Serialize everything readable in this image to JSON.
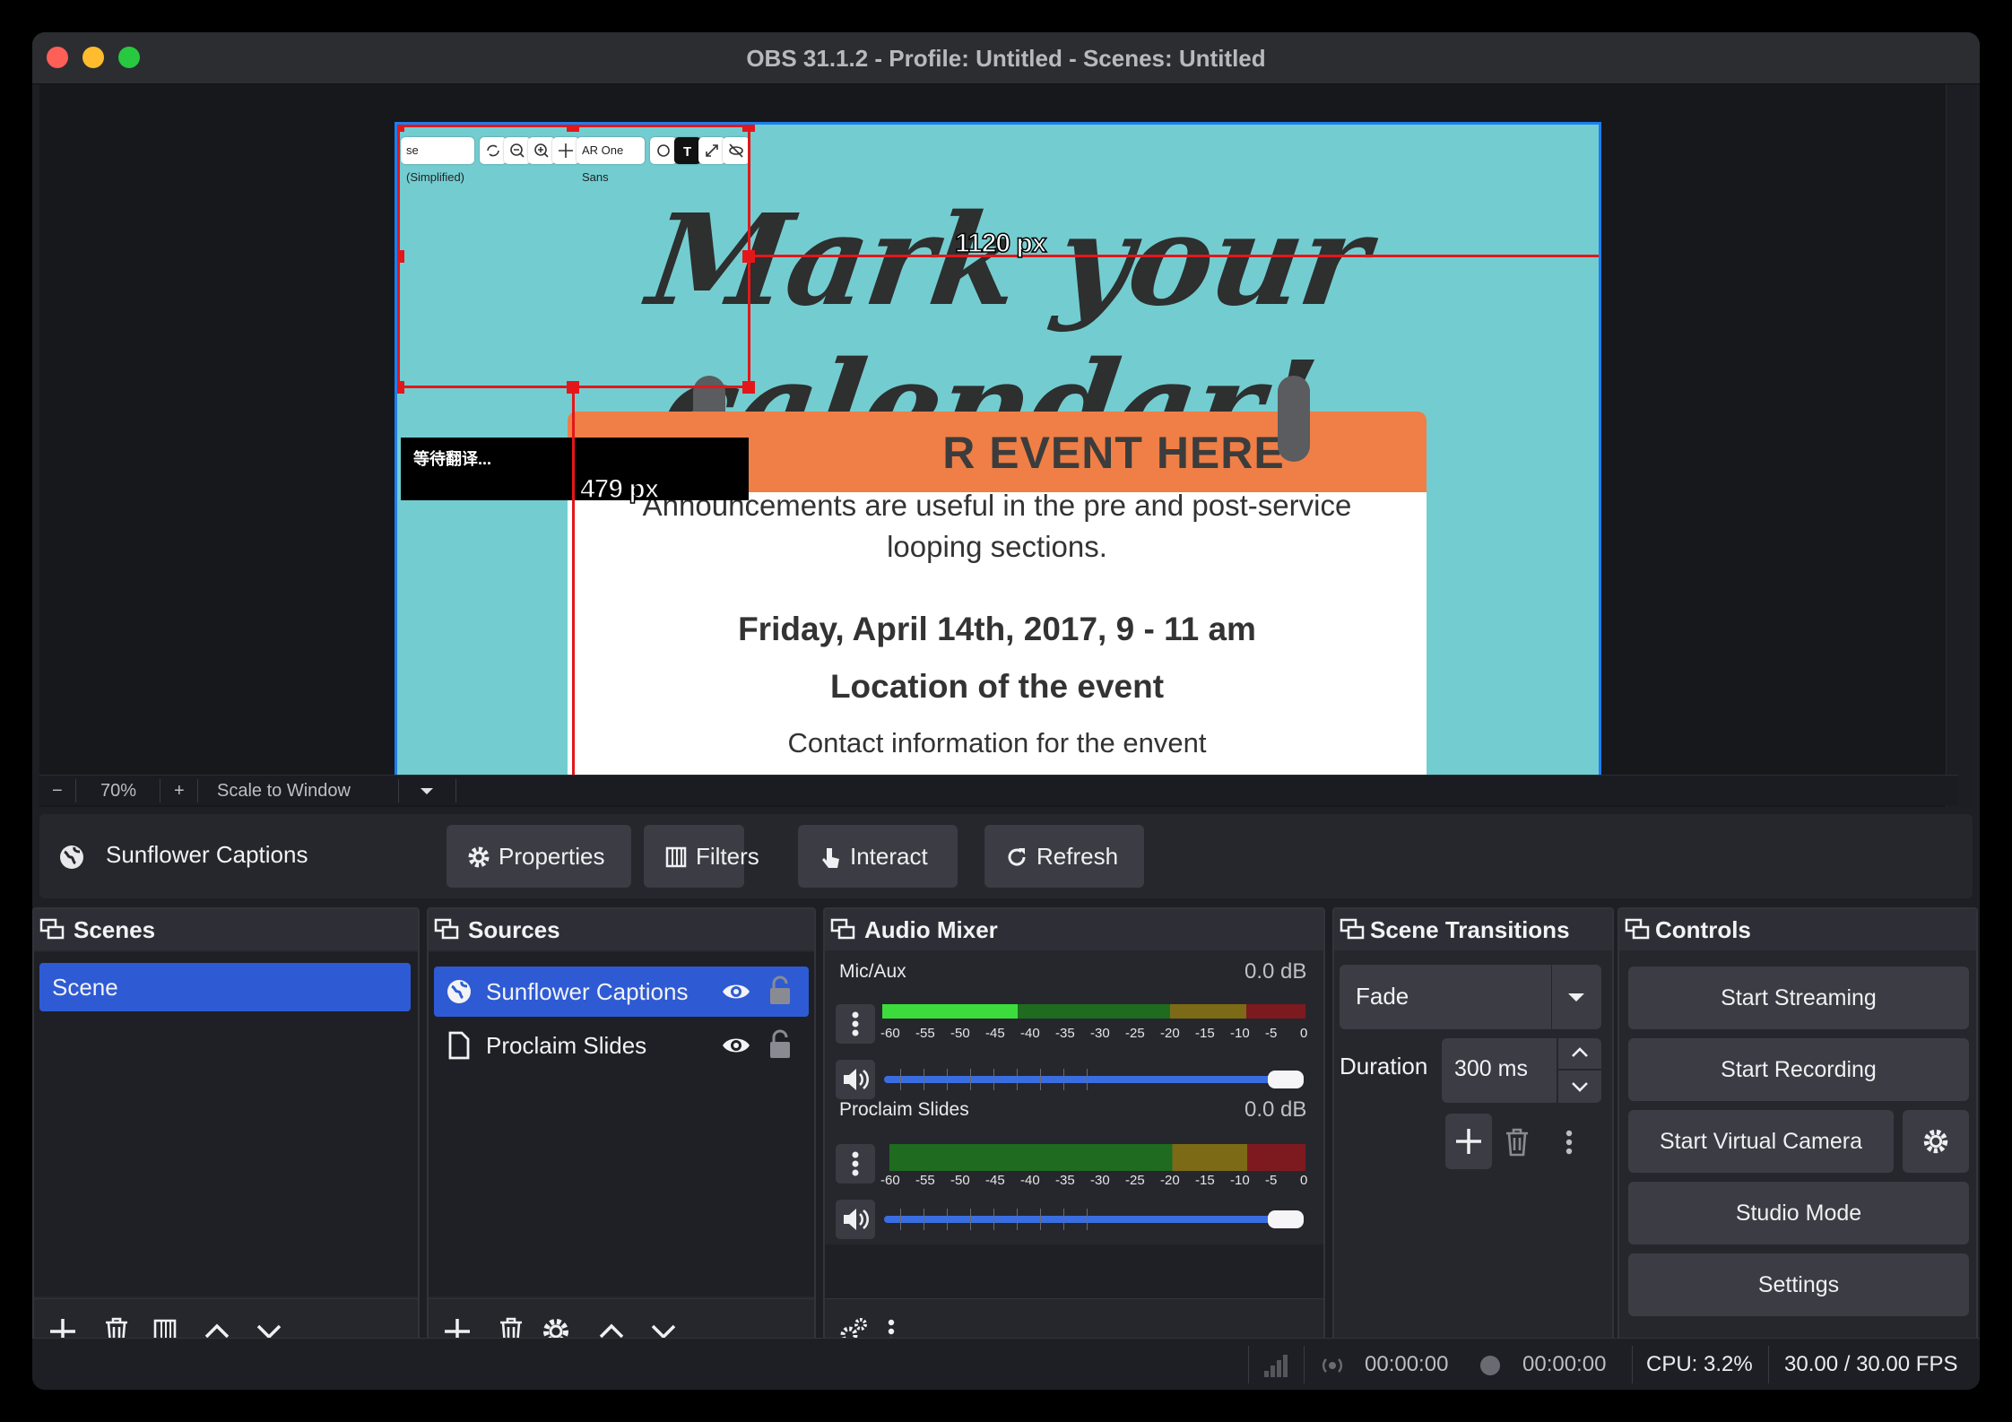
{
  "window": {
    "title": "OBS 31.1.2 - Profile: Untitled - Scenes: Untitled",
    "traffic_colors": {
      "close": "#ff5f57",
      "minimize": "#febc2e",
      "zoom": "#28c840"
    }
  },
  "preview": {
    "slide": {
      "headline": "Mark your calendar!",
      "header_text": "R EVENT HERE",
      "announcement_1": "Announcements are useful in the pre and post-service",
      "announcement_2": "looping sections.",
      "date": "Friday, April 14th, 2017, 9 - 11 am",
      "location": "Location of the event",
      "contact": "Contact information for the envent"
    },
    "caption": {
      "text": "等待翻译...",
      "language_select": "se (Simplified)",
      "font_select": "AR One Sans"
    },
    "measure": {
      "width_label": "1120 px",
      "height_label": "479 px"
    }
  },
  "zoombar": {
    "minus": "−",
    "zoom": "70%",
    "plus": "+",
    "scale_mode": "Scale to Window"
  },
  "context": {
    "source_name": "Sunflower Captions",
    "properties": "Properties",
    "filters": "Filters",
    "interact": "Interact",
    "refresh": "Refresh"
  },
  "scenes": {
    "title": "Scenes",
    "items": [
      {
        "label": "Scene",
        "selected": true
      }
    ]
  },
  "sources": {
    "title": "Sources",
    "items": [
      {
        "label": "Sunflower Captions",
        "selected": true,
        "icon": "globe-icon"
      },
      {
        "label": "Proclaim Slides",
        "selected": false,
        "icon": "file-icon"
      }
    ]
  },
  "mixer": {
    "title": "Audio Mixer",
    "channels": [
      {
        "name": "Mic/Aux",
        "db": "0.0 dB",
        "level": 0.32
      },
      {
        "name": "Proclaim Slides",
        "db": "0.0 dB",
        "level": 0
      }
    ],
    "ticks": [
      "-60",
      "-55",
      "-50",
      "-45",
      "-40",
      "-35",
      "-30",
      "-25",
      "-20",
      "-15",
      "-10",
      "-5",
      "0"
    ]
  },
  "transitions": {
    "title": "Scene Transitions",
    "selected": "Fade",
    "duration_label": "Duration",
    "duration_value": "300 ms"
  },
  "controls": {
    "title": "Controls",
    "start_streaming": "Start Streaming",
    "start_recording": "Start Recording",
    "start_virtual_camera": "Start Virtual Camera",
    "studio_mode": "Studio Mode",
    "settings": "Settings"
  },
  "status": {
    "stream_time": "00:00:00",
    "record_time": "00:00:00",
    "cpu": "CPU: 3.2%",
    "fps": "30.00 / 30.00 FPS"
  },
  "colors": {
    "accent": "#2e5bd4",
    "selection": "#e3171a",
    "canvas_border": "#1e7ef0",
    "calendar_header": "#ef7f46",
    "canvas_bg": "#73cdd0"
  }
}
